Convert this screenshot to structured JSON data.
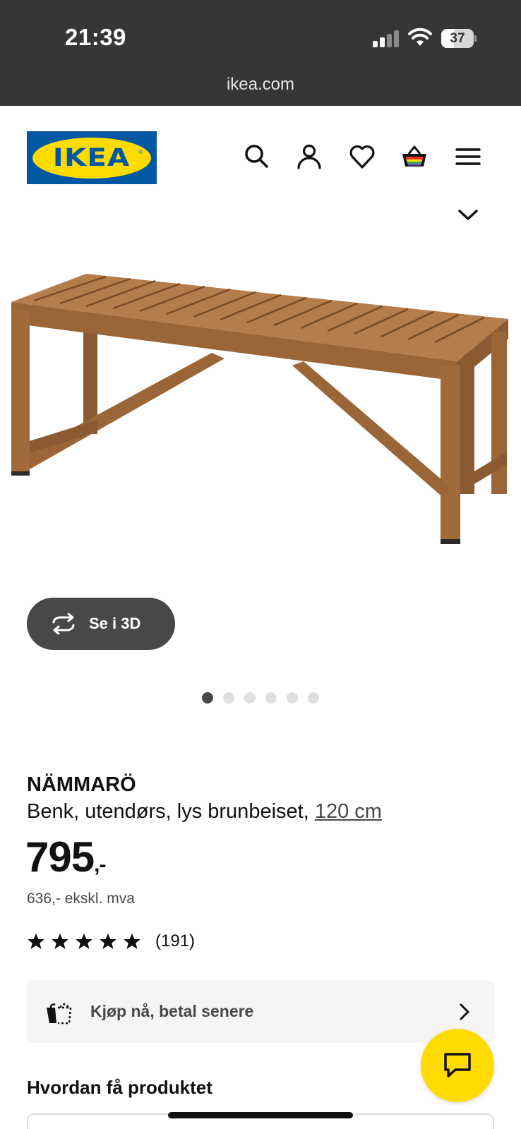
{
  "status_bar": {
    "time": "21:39",
    "battery": "37",
    "battery_level": 0.37
  },
  "browser": {
    "url": "ikea.com"
  },
  "header": {
    "logo_text": "IKEA",
    "icons": [
      "search-icon",
      "account-icon",
      "heart-icon",
      "cart-icon",
      "menu-icon"
    ]
  },
  "gallery": {
    "view_3d_label": "Se i 3D",
    "image_count": 6,
    "active_index": 0
  },
  "product": {
    "name": "NÄMMARÖ",
    "description": "Benk, utendørs, lys brunbeiset,",
    "size_link": "120 cm",
    "price": "795",
    "price_suffix": ",-",
    "price_ex_vat": "636,- ekskl. mva",
    "rating_stars": 5,
    "review_count": "(191)"
  },
  "bnpl": {
    "label": "Kjøp nå, betal senere"
  },
  "section": {
    "how_to_get": "Hvordan få produktet"
  },
  "colors": {
    "ikea_blue": "#0058a3",
    "ikea_yellow": "#ffdb00",
    "dark": "#111111"
  }
}
